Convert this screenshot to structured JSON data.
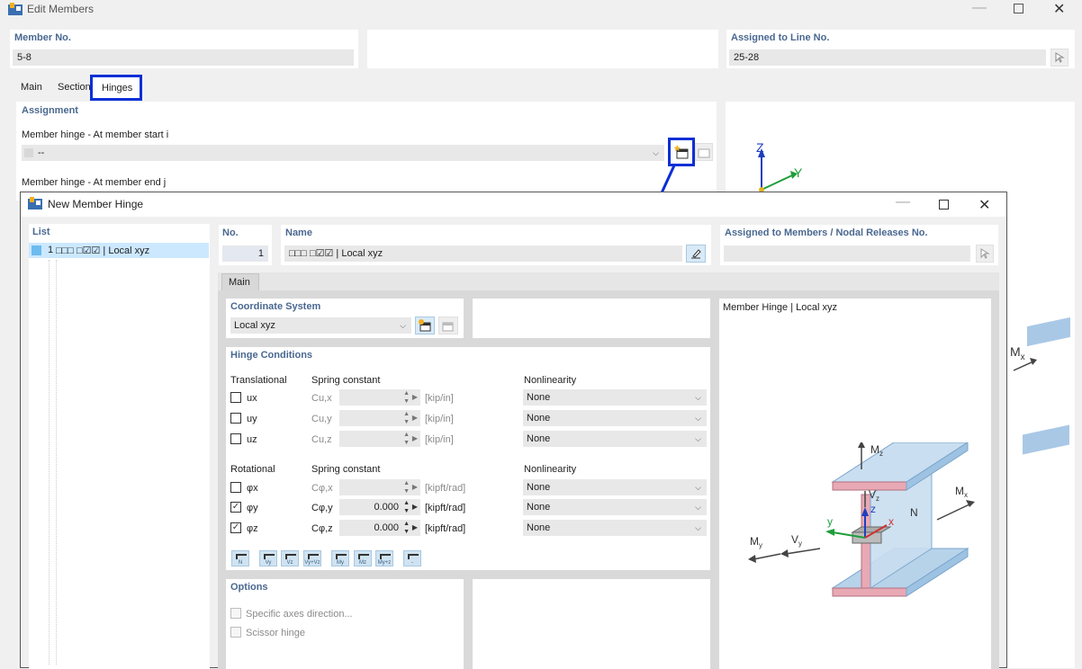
{
  "main_window": {
    "title": "Edit Members",
    "member_no_label": "Member No.",
    "member_no_value": "5-8",
    "assigned_line_label": "Assigned to Line No.",
    "assigned_line_value": "25-28",
    "tabs": [
      "Main",
      "Section",
      "Hinges"
    ],
    "active_tab": "Hinges",
    "assignment_label": "Assignment",
    "hinge_start_label": "Member hinge - At member start i",
    "hinge_start_value": "--",
    "hinge_end_label": "Member hinge - At member end j",
    "axis_z": "Z",
    "axis_y": "Y",
    "bg_mx": "M",
    "bg_mx_sub": "x"
  },
  "dialog": {
    "title": "New Member Hinge",
    "list_label": "List",
    "list_items": [
      {
        "number": "1",
        "text": "□□□ □☑☑ | Local xyz"
      }
    ],
    "no_label": "No.",
    "no_value": "1",
    "name_label": "Name",
    "name_value": "□□□ □☑☑ | Local xyz",
    "assigned_label": "Assigned to Members / Nodal Releases No.",
    "assigned_value": "",
    "tab_main": "Main",
    "coord_label": "Coordinate System",
    "coord_value": "Local xyz",
    "hinge_cond_label": "Hinge Conditions",
    "translational_label": "Translational",
    "rotational_label": "Rotational",
    "spring_label": "Spring constant",
    "nonlin_label": "Nonlinearity",
    "trans_rows": [
      {
        "name": "ux",
        "symbol": "Cu,x",
        "value": "",
        "unit": "[kip/in]",
        "checked": false,
        "nonlin": "None"
      },
      {
        "name": "uy",
        "symbol": "Cu,y",
        "value": "",
        "unit": "[kip/in]",
        "checked": false,
        "nonlin": "None"
      },
      {
        "name": "uz",
        "symbol": "Cu,z",
        "value": "",
        "unit": "[kip/in]",
        "checked": false,
        "nonlin": "None"
      }
    ],
    "rot_rows": [
      {
        "name": "φx",
        "symbol": "Cφ,x",
        "value": "",
        "unit": "[kipft/rad]",
        "checked": false,
        "nonlin": "None"
      },
      {
        "name": "φy",
        "symbol": "Cφ,y",
        "value": "0.000",
        "unit": "[kipft/rad]",
        "checked": true,
        "nonlin": "None"
      },
      {
        "name": "φz",
        "symbol": "Cφ,z",
        "value": "0.000",
        "unit": "[kipft/rad]",
        "checked": true,
        "nonlin": "None"
      }
    ],
    "preset_buttons": [
      "N",
      "Vy",
      "Vz",
      "Vy+Vz",
      "My",
      "Mz",
      "My+z",
      "-"
    ],
    "options_label": "Options",
    "opt_specific_axes": "Specific axes direction...",
    "opt_scissor": "Scissor hinge",
    "preview_title": "Member Hinge | Local xyz",
    "diagram_labels": {
      "mz": "M",
      "mz_sub": "z",
      "vz": "V",
      "vz_sub": "z",
      "mx": "M",
      "mx_sub": "x",
      "n": "N",
      "my": "M",
      "my_sub": "y",
      "vy": "V",
      "vy_sub": "y",
      "y": "y",
      "z": "z",
      "x": "x"
    }
  },
  "colors": {
    "highlight_blue": "#0a2fd6",
    "header_text": "#4a6890",
    "list_selected": "#cce8ff",
    "steel_blue": "#b7d3ea",
    "steel_pink": "#e8a9b4"
  }
}
